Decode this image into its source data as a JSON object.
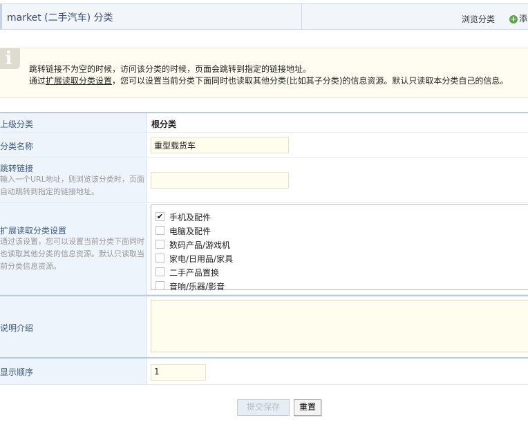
{
  "header": {
    "title": "market (二手汽车) 分类",
    "browse_link": "浏览分类",
    "add_link": "添"
  },
  "notice": {
    "line1": "跳转链接不为空的时候，访问该分类的时候，页面会跳转到指定的链接地址。",
    "line2_prefix": "通过",
    "line2_link": "扩展读取分类设置",
    "line2_suffix": "，您可以设置当前分类下面同时也读取其他分类(比如其子分类)的信息资源。默认只读取本分类自己的信息。"
  },
  "form": {
    "parent": {
      "label": "上级分类",
      "value": "根分类"
    },
    "name": {
      "label": "分类名称",
      "value": "重型载货车"
    },
    "redirect": {
      "label": "跳转链接",
      "help": "输入一个URL地址，则浏览该分类时，页面自动跳转到指定的链接地址。",
      "value": ""
    },
    "extend": {
      "label": "扩展读取分类设置",
      "help": "通过该设置，您可以设置当前分类下面同时也读取其他分类的信息资源。默认只读取当前分类信息资源。",
      "options": [
        {
          "label": "手机及配件",
          "checked": true
        },
        {
          "label": "电脑及配件",
          "checked": false
        },
        {
          "label": "数码产品/游戏机",
          "checked": false
        },
        {
          "label": "家电/日用品/家具",
          "checked": false
        },
        {
          "label": "二手产品置换",
          "checked": false
        },
        {
          "label": "音响/乐器/影音",
          "checked": false
        }
      ]
    },
    "description": {
      "label": "说明介绍",
      "value": ""
    },
    "order": {
      "label": "显示顺序",
      "value": "1"
    }
  },
  "buttons": {
    "submit": "提交保存",
    "reset": "重置"
  },
  "colors": {
    "label_bg": "#eef4fb",
    "input_bg": "#fffdee",
    "notice_bg": "#fffdf2",
    "accent_green": "#5aa54a"
  }
}
